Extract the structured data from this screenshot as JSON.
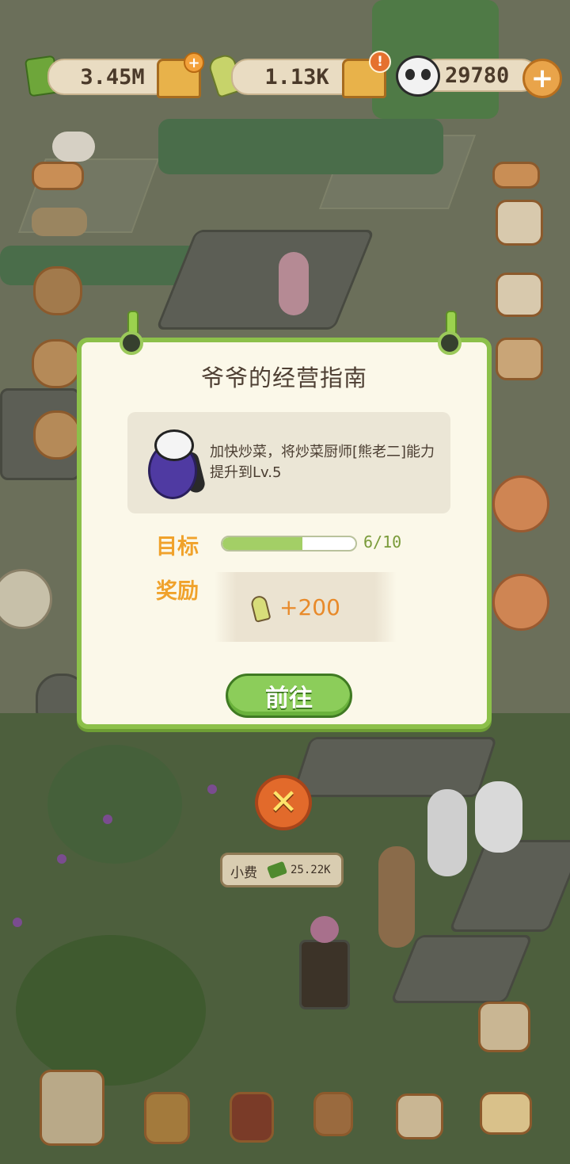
{
  "hud": {
    "cash_value": "3.45M",
    "bamboo_value": "1.13K",
    "panda_value": "29780",
    "plus_symbol": "+",
    "alert_symbol": "!",
    "add_symbol": "+"
  },
  "modal": {
    "title": "爷爷的经营指南",
    "task_description": "加快炒菜，将炒菜厨师[熊老二]能力提升到Lv.5",
    "goal_label": "目标",
    "progress_text": "6/10",
    "progress_fraction": 0.6,
    "reward_label": "奖励",
    "reward_amount": "+200",
    "go_button_label": "前往",
    "close_symbol": "✕"
  },
  "world": {
    "tip_label": "小费",
    "tip_value": "25.22K"
  },
  "colors": {
    "modal_border": "#8cc04a",
    "label_orange": "#f0a22b",
    "go_button": "#8ccd5a",
    "close_button": "#e26a2b"
  }
}
